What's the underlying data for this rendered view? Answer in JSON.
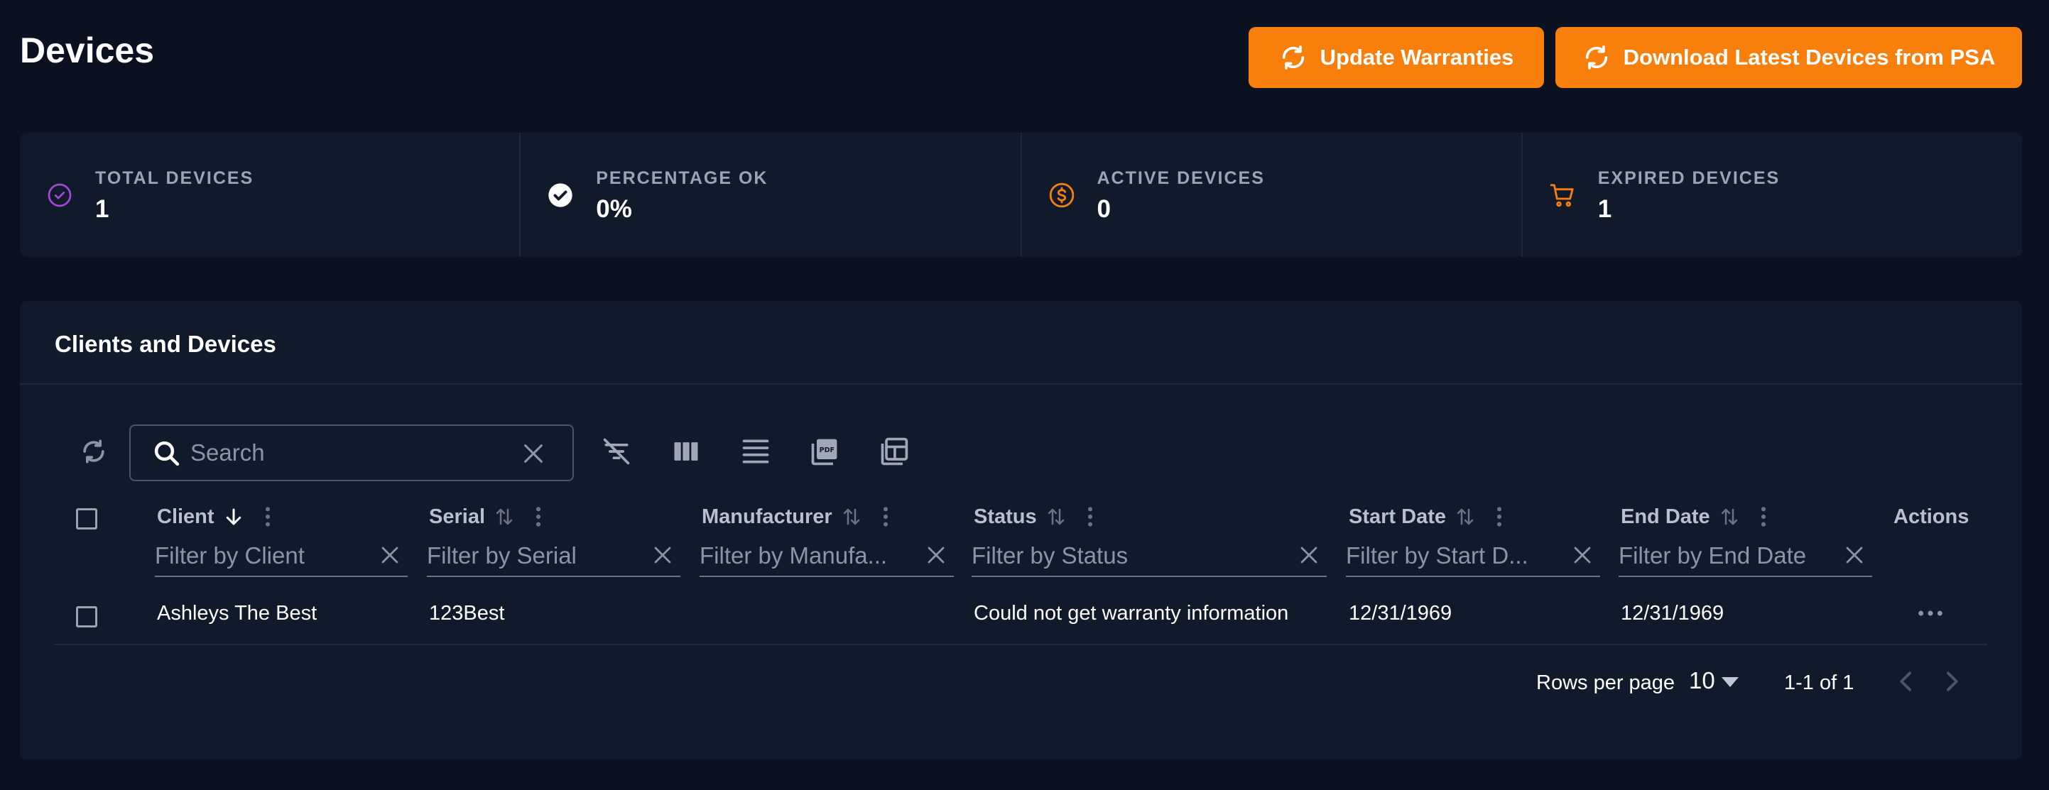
{
  "page": {
    "title": "Devices"
  },
  "buttons": {
    "update_warranties": "Update Warranties",
    "download_devices": "Download Latest Devices from PSA"
  },
  "stats": [
    {
      "label": "TOTAL DEVICES",
      "value": "1",
      "icon": "check-circle-icon",
      "color": "#a24ad8"
    },
    {
      "label": "PERCENTAGE OK",
      "value": "0%",
      "icon": "check-circle-filled-icon",
      "color": "#ffffff"
    },
    {
      "label": "ACTIVE DEVICES",
      "value": "0",
      "icon": "dollar-circle-icon",
      "color": "#f97f0c"
    },
    {
      "label": "EXPIRED DEVICES",
      "value": "1",
      "icon": "cart-icon",
      "color": "#f97f0c"
    }
  ],
  "panel": {
    "title": "Clients and Devices"
  },
  "toolbar": {
    "search_placeholder": "Search",
    "icons": [
      "refresh-icon",
      "clear-filters-icon",
      "columns-icon",
      "density-icon",
      "pdf-export-icon",
      "layout-icon"
    ]
  },
  "table": {
    "columns": [
      {
        "title": "Client",
        "filter_placeholder": "Filter by Client"
      },
      {
        "title": "Serial",
        "filter_placeholder": "Filter by Serial"
      },
      {
        "title": "Manufacturer",
        "filter_placeholder": "Filter by Manufa..."
      },
      {
        "title": "Status",
        "filter_placeholder": "Filter by Status"
      },
      {
        "title": "Start Date",
        "filter_placeholder": "Filter by Start D..."
      },
      {
        "title": "End Date",
        "filter_placeholder": "Filter by End Date"
      },
      {
        "title": "Actions"
      }
    ],
    "rows": [
      {
        "client": "Ashleys The Best",
        "serial": "123Best",
        "manufacturer": "",
        "status": "Could not get warranty information",
        "start_date": "12/31/1969",
        "end_date": "12/31/1969"
      }
    ]
  },
  "pagination": {
    "rows_per_page_label": "Rows per page",
    "rows_per_page_value": "10",
    "range": "1-1 of 1"
  },
  "colors": {
    "accent": "#f97f0c",
    "background": "#0b1120",
    "panel": "#111a2b"
  }
}
